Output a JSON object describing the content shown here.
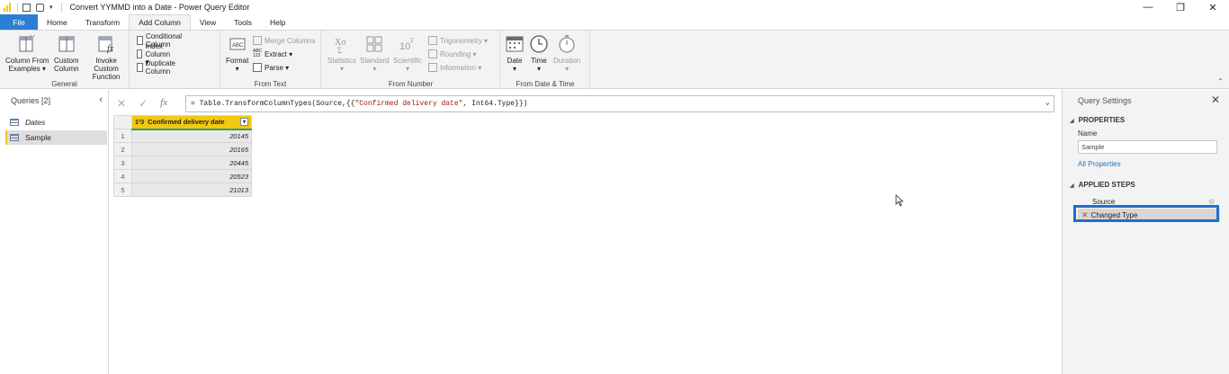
{
  "window": {
    "title": "Convert YYMMD into a Date - Power Query Editor",
    "minimize": "—",
    "maximize": "❒",
    "close": "✕"
  },
  "tabs": [
    "File",
    "Home",
    "Transform",
    "Add Column",
    "View",
    "Tools",
    "Help"
  ],
  "active_tab": "Add Column",
  "ribbon": {
    "general": {
      "label": "General",
      "column_from_examples": [
        "Column From",
        "Examples ▾"
      ],
      "custom_column": [
        "Custom",
        "Column"
      ],
      "invoke_custom_function": [
        "Invoke Custom",
        "Function"
      ],
      "conditional_column": "Conditional Column",
      "index_column": "Index Column ▾",
      "duplicate_column": "Duplicate Column"
    },
    "from_text": {
      "label": "From Text",
      "format": [
        "Format",
        "▾"
      ],
      "merge_columns": "Merge Columns",
      "extract": "Extract ▾",
      "parse": "Parse ▾"
    },
    "from_number": {
      "label": "From Number",
      "statistics": [
        "Statistics",
        "▾"
      ],
      "standard": [
        "Standard",
        "▾"
      ],
      "scientific": [
        "Scientific",
        "▾"
      ],
      "trigonometry": "Trigonometry ▾",
      "rounding": "Rounding ▾",
      "information": "Information ▾"
    },
    "from_date_time": {
      "label": "From Date & Time",
      "date": [
        "Date",
        "▾"
      ],
      "time": [
        "Time",
        "▾"
      ],
      "duration": [
        "Duration",
        "▾"
      ]
    }
  },
  "queries": {
    "header": "Queries [2]",
    "collapse": "‹",
    "items": [
      {
        "label": "Dates"
      },
      {
        "label": "Sample"
      }
    ]
  },
  "formula_bar": {
    "cancel": "✕",
    "commit": "✓",
    "fx": "fx",
    "formula_prefix": "= Table.TransformColumnTypes(Source,{{",
    "formula_string": "\"Confirmed delivery date\"",
    "formula_suffix": ", Int64.Type}})",
    "expand": "⌄"
  },
  "grid": {
    "column_type": "1²3",
    "column_header": "Confirmed delivery date",
    "rows": [
      {
        "n": "1",
        "v": "20145"
      },
      {
        "n": "2",
        "v": "20165"
      },
      {
        "n": "3",
        "v": "20445"
      },
      {
        "n": "4",
        "v": "20523"
      },
      {
        "n": "5",
        "v": "21013"
      }
    ]
  },
  "query_settings": {
    "header": "Query Settings",
    "close": "✕",
    "properties_label": "PROPERTIES",
    "name_label": "Name",
    "name_value": "Sample",
    "all_properties": "All Properties",
    "applied_steps_label": "APPLIED STEPS",
    "steps": [
      {
        "label": "Source"
      },
      {
        "label": "Changed Type"
      }
    ]
  },
  "colors": {
    "file_tab": "#2b7fd4",
    "column_header": "#f2c811",
    "highlight_box": "#1f70c9",
    "link": "#2b6fc0"
  }
}
